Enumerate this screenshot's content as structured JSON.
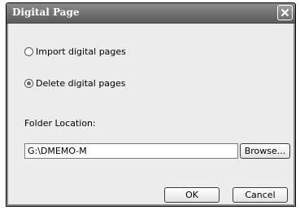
{
  "window": {
    "title": "Digital Page"
  },
  "options": {
    "import_label": "Import digital pages",
    "import_checked": false,
    "delete_label": "Delete digital pages",
    "delete_checked": true
  },
  "folder": {
    "label": "Folder Location:",
    "path_value": "G:\\DMEMO-M",
    "browse_label": "Browse..."
  },
  "buttons": {
    "ok_label": "OK",
    "cancel_label": "Cancel"
  },
  "icons": {
    "close": "close-icon"
  }
}
